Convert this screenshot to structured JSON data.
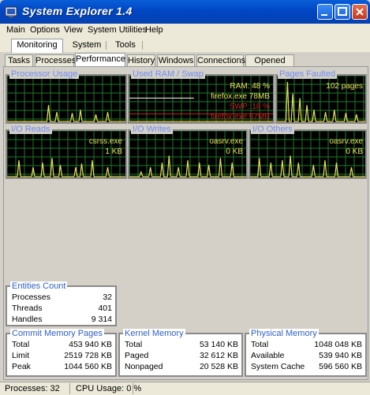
{
  "window": {
    "title": "System Explorer 1.4",
    "icon": "app-icon"
  },
  "menu": [
    "Main",
    "Options",
    "View",
    "System Utilities",
    "Help"
  ],
  "main_tabs": [
    "Monitoring",
    "System",
    "Tools"
  ],
  "sub_tabs": [
    "Tasks",
    "Processes",
    "Performance",
    "History",
    "Windows",
    "Connections",
    "Opened Files"
  ],
  "active_sub_tab": "Performance",
  "graphs": {
    "cpu": {
      "title": "Processor Usage"
    },
    "ram": {
      "title": "Used RAM / Swap",
      "ram": "RAM: 48 %",
      "ram_proc": "firefox.exe 78MB",
      "swp": "SWP: 18 %",
      "swp_proc": "firefox.exe 67MB"
    },
    "pf": {
      "title": "Pages Faulted",
      "value": "102 pages"
    },
    "ior": {
      "title": "I/O Reads",
      "proc": "csrss.exe",
      "value": "1 KB"
    },
    "iow": {
      "title": "I/O Writes",
      "proc": "oasrv.exe",
      "value": "0 KB"
    },
    "ioo": {
      "title": "I/O Others",
      "proc": "oasrv.exe",
      "value": "0 KB"
    }
  },
  "entities": {
    "title": "Entities Count",
    "rows": [
      {
        "label": "Processes",
        "value": "32"
      },
      {
        "label": "Threads",
        "value": "401"
      },
      {
        "label": "Handles",
        "value": "9 314"
      }
    ]
  },
  "commit": {
    "title": "Commit Memory Pages",
    "rows": [
      {
        "label": "Total",
        "value": "453 940 KB"
      },
      {
        "label": "Limit",
        "value": "2519 728 KB"
      },
      {
        "label": "Peak",
        "value": "1044 560 KB"
      }
    ]
  },
  "kernel": {
    "title": "Kernel Memory",
    "rows": [
      {
        "label": "Total",
        "value": "53 140 KB"
      },
      {
        "label": "Paged",
        "value": "32 612 KB"
      },
      {
        "label": "Nonpaged",
        "value": "20 528 KB"
      }
    ]
  },
  "physical": {
    "title": "Physical Memory",
    "rows": [
      {
        "label": "Total",
        "value": "1048 048 KB"
      },
      {
        "label": "Available",
        "value": "539 940 KB"
      },
      {
        "label": "System Cache",
        "value": "596 560 KB"
      }
    ]
  },
  "status": {
    "processes": "Processes: 32",
    "cpu": "CPU Usage: 0 %"
  },
  "colors": {
    "graph_line": "#e6e05a",
    "grid": "#1f7a2a",
    "swap_line": "#c82020",
    "ram_line": "#ffffff"
  }
}
